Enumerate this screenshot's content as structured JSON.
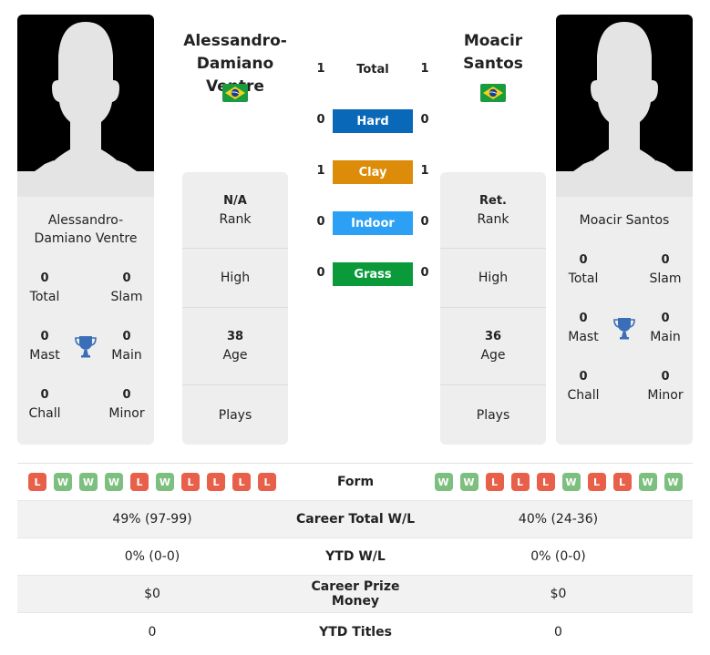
{
  "colors": {
    "win": "#7dbf7f",
    "loss": "#e8604a",
    "hard": "#0a68b8",
    "clay": "#dc8c08",
    "indoor": "#2ba0f5",
    "grass": "#0a9a3a",
    "trophy": "#3a6fb8"
  },
  "player1": {
    "name_header": "Alessandro-Damiano Ventre",
    "name_card": "Alessandro-Damiano Ventre",
    "flag": "brazil-flag",
    "titles": {
      "total": "0",
      "total_label": "Total",
      "slam": "0",
      "slam_label": "Slam",
      "mast": "0",
      "mast_label": "Mast",
      "main": "0",
      "main_label": "Main",
      "chall": "0",
      "chall_label": "Chall",
      "minor": "0",
      "minor_label": "Minor"
    },
    "rank_value": "N/A",
    "rank_label": "Rank",
    "high_label": "High",
    "age_value": "38",
    "age_label": "Age",
    "plays_label": "Plays",
    "form": [
      "L",
      "W",
      "W",
      "W",
      "L",
      "W",
      "L",
      "L",
      "L",
      "L"
    ],
    "career_wl": "49% (97-99)",
    "ytd_wl": "0% (0-0)",
    "prize": "$0",
    "ytd_titles": "0"
  },
  "player2": {
    "name_header": "Moacir Santos",
    "name_card": "Moacir Santos",
    "flag": "brazil-flag",
    "titles": {
      "total": "0",
      "total_label": "Total",
      "slam": "0",
      "slam_label": "Slam",
      "mast": "0",
      "mast_label": "Mast",
      "main": "0",
      "main_label": "Main",
      "chall": "0",
      "chall_label": "Chall",
      "minor": "0",
      "minor_label": "Minor"
    },
    "rank_value": "Ret.",
    "rank_label": "Rank",
    "high_label": "High",
    "age_value": "36",
    "age_label": "Age",
    "plays_label": "Plays",
    "form": [
      "W",
      "W",
      "L",
      "L",
      "L",
      "W",
      "L",
      "L",
      "W",
      "W"
    ],
    "career_wl": "40% (24-36)",
    "ytd_wl": "0% (0-0)",
    "prize": "$0",
    "ytd_titles": "0"
  },
  "h2h": {
    "total": {
      "label": "Total",
      "p1": "1",
      "p2": "1"
    },
    "hard": {
      "label": "Hard",
      "p1": "0",
      "p2": "0"
    },
    "clay": {
      "label": "Clay",
      "p1": "1",
      "p2": "1"
    },
    "indoor": {
      "label": "Indoor",
      "p1": "0",
      "p2": "0"
    },
    "grass": {
      "label": "Grass",
      "p1": "0",
      "p2": "0"
    }
  },
  "table": {
    "form_label": "Form",
    "career_label": "Career Total W/L",
    "ytd_label": "YTD W/L",
    "prize_label": "Career Prize Money",
    "titles_label": "YTD Titles"
  }
}
